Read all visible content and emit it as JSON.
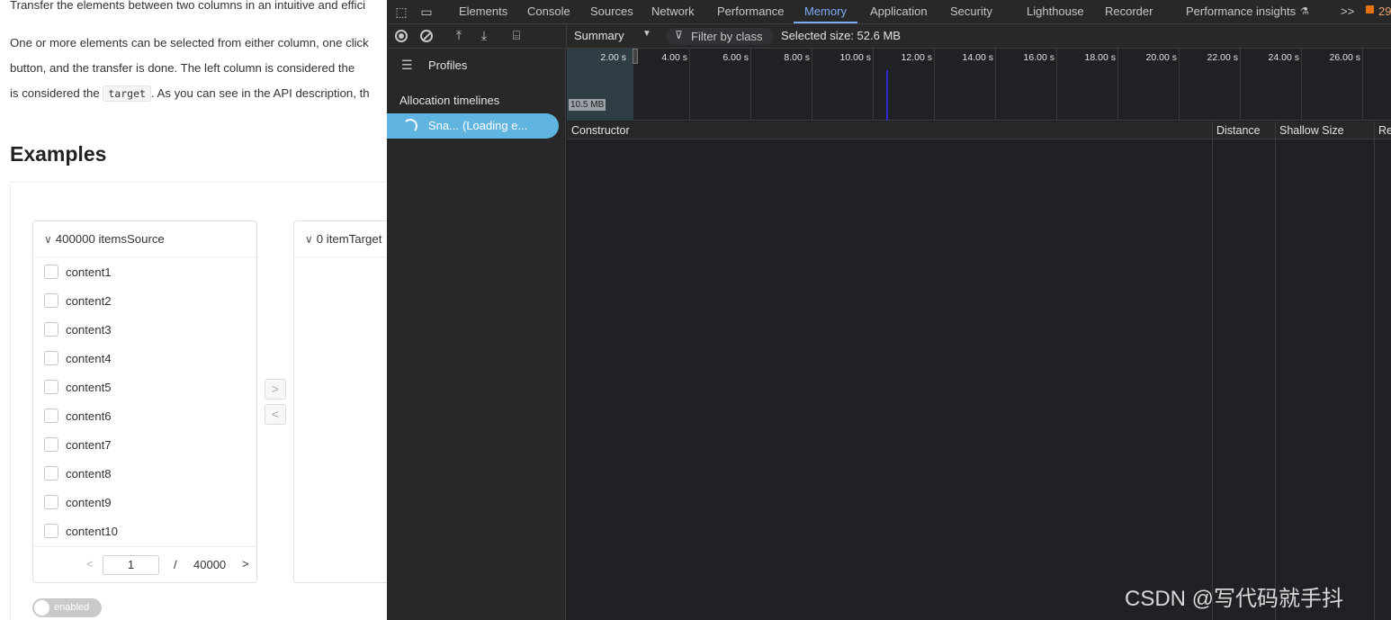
{
  "doc": {
    "line1": "Transfer the elements between two columns in an intuitive and effici",
    "line2": "One or more elements can be selected from either column, one click",
    "line3a": "button, and the transfer is done. The left column is considered the",
    "line4a": "is considered the",
    "line4code": "target",
    "line4b": ". As you can see in the API description, th",
    "examples_title": "Examples"
  },
  "transfer": {
    "source_header": "400000 itemsSource",
    "target_header": "0 itemTarget",
    "items": [
      "content1",
      "content2",
      "content3",
      "content4",
      "content5",
      "content6",
      "content7",
      "content8",
      "content9",
      "content10"
    ],
    "page_current": "1",
    "page_sep": "/",
    "page_total": "40000",
    "move_right": ">",
    "move_left": "<",
    "switch_label": "enabled"
  },
  "devtools": {
    "tabs": [
      "Elements",
      "Console",
      "Sources",
      "Network",
      "Performance",
      "Memory",
      "Application",
      "Security",
      "Lighthouse",
      "Recorder",
      "Performance insights"
    ],
    "active_tab": "Memory",
    "more_tabs": ">>",
    "issue_count": "29",
    "toolbar": {
      "view_select": "Summary",
      "filter_label": "Filter by class",
      "selected_size": "Selected size: 52.6 MB"
    },
    "sidebar": {
      "profiles_label": "Profiles",
      "section_label": "Allocation timelines",
      "snapshot_name": "Sna...",
      "snapshot_status": "(Loading e..."
    },
    "timeline": {
      "ticks": [
        "2.00 s",
        "4.00 s",
        "6.00 s",
        "8.00 s",
        "10.00 s",
        "12.00 s",
        "14.00 s",
        "16.00 s",
        "18.00 s",
        "20.00 s",
        "22.00 s",
        "24.00 s",
        "26.00 s"
      ],
      "mem_label": "10.5 MB"
    },
    "columns": [
      "Constructor",
      "Distance",
      "Shallow Size",
      "Re"
    ]
  },
  "watermark": "CSDN @写代码就手抖",
  "colors": {
    "accent": "#7cacf8",
    "selected_row": "#5fb4e0",
    "bg": "#202124",
    "panel": "#282828"
  }
}
